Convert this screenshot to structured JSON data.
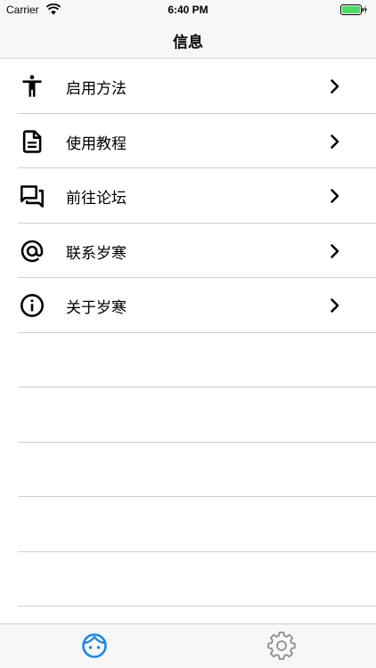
{
  "status_bar": {
    "carrier": "Carrier",
    "time": "6:40 PM",
    "battery_color": "#4cd964"
  },
  "nav": {
    "title": "信息"
  },
  "menu": [
    {
      "label": "启用方法",
      "icon": "accessibility-icon"
    },
    {
      "label": "使用教程",
      "icon": "document-icon"
    },
    {
      "label": "前往论坛",
      "icon": "forum-icon"
    },
    {
      "label": "联系岁寒",
      "icon": "at-sign-icon"
    },
    {
      "label": "关于岁寒",
      "icon": "info-icon"
    }
  ],
  "tabs": [
    {
      "icon": "face-icon",
      "selected": true,
      "color": "#1e88e5"
    },
    {
      "icon": "gear-icon",
      "selected": false,
      "color": "#8e8e93"
    }
  ]
}
